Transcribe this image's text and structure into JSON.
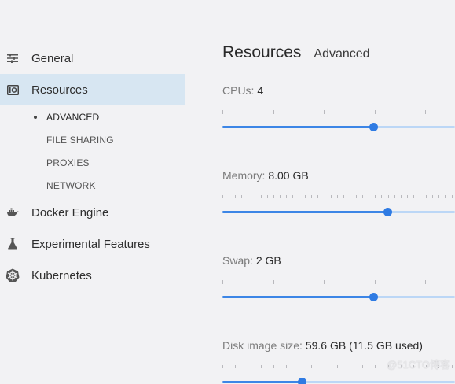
{
  "sidebar": {
    "items": [
      {
        "label": "General",
        "icon": "sliders-icon"
      },
      {
        "label": "Resources",
        "icon": "resources-icon"
      },
      {
        "label": "Docker Engine",
        "icon": "whale-icon"
      },
      {
        "label": "Experimental Features",
        "icon": "flask-icon"
      },
      {
        "label": "Kubernetes",
        "icon": "helm-icon"
      }
    ],
    "sub_items": [
      "ADVANCED",
      "FILE SHARING",
      "PROXIES",
      "NETWORK"
    ]
  },
  "main": {
    "title": "Resources",
    "tab": "Advanced",
    "settings": [
      {
        "label": "CPUs:",
        "value": "4",
        "level": 0.65
      },
      {
        "label": "Memory:",
        "value": "8.00 GB",
        "level": 0.71
      },
      {
        "label": "Swap:",
        "value": "2 GB",
        "level": 0.65
      },
      {
        "label": "Disk image size:",
        "value": "59.6 GB (11.5 GB used)",
        "level": 0.34
      }
    ]
  },
  "watermark": "@51CTO博客",
  "colors": {
    "accent": "#3d86e6",
    "active_bg": "#d7e6f2",
    "track": "#bcd7f6"
  }
}
